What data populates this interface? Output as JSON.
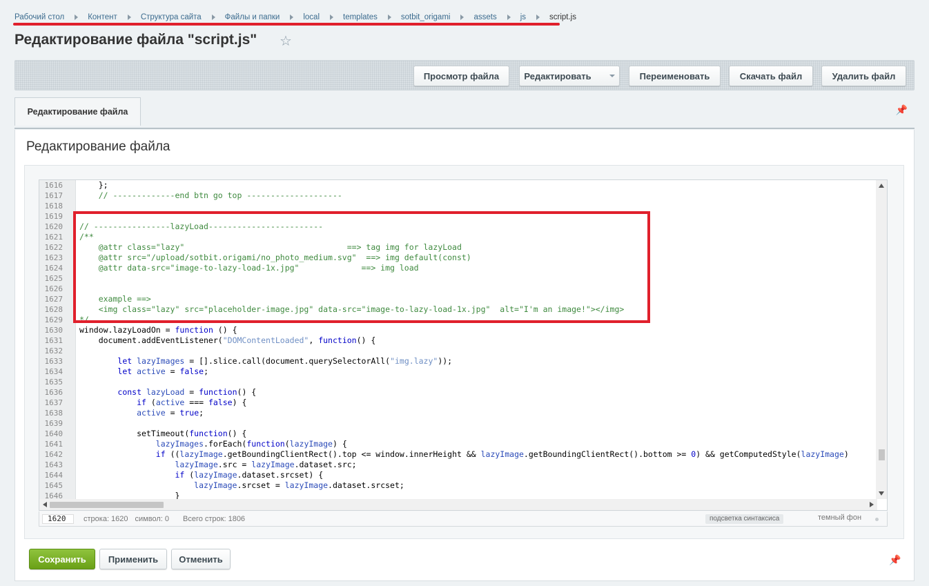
{
  "breadcrumb": {
    "items": [
      "Рабочий стол",
      "Контент",
      "Структура сайта",
      "Файлы и папки",
      "local",
      "templates",
      "sotbit_origami",
      "assets",
      "js",
      "script.js"
    ]
  },
  "page": {
    "title": "Редактирование файла \"script.js\""
  },
  "toolbar": {
    "view_label": "Просмотр файла",
    "edit_label": "Редактировать",
    "rename_label": "Переименовать",
    "download_label": "Скачать файл",
    "delete_label": "Удалить файл"
  },
  "tabs": [
    {
      "label": "Редактирование файла"
    }
  ],
  "panel": {
    "title": "Редактирование файла"
  },
  "editor": {
    "lines": [
      {
        "n": "1616",
        "parts": [
          {
            "t": "    };",
            "c": ""
          }
        ]
      },
      {
        "n": "1617",
        "parts": [
          {
            "t": "    // -------------end btn go top --------------------",
            "c": "cm"
          }
        ]
      },
      {
        "n": "1618",
        "parts": []
      },
      {
        "n": "1619",
        "parts": []
      },
      {
        "n": "1620",
        "parts": [
          {
            "t": "// ----------------lazyLoad------------------------",
            "c": "cm"
          }
        ]
      },
      {
        "n": "1621",
        "parts": [
          {
            "t": "/**",
            "c": "cm"
          }
        ]
      },
      {
        "n": "1622",
        "parts": [
          {
            "t": "    @attr class=\"lazy\"                                  ==> tag img for lazyLoad",
            "c": "cm"
          }
        ]
      },
      {
        "n": "1623",
        "parts": [
          {
            "t": "    @attr src=\"/upload/sotbit.origami/no_photo_medium.svg\"  ==> img default(const)",
            "c": "cm"
          }
        ]
      },
      {
        "n": "1624",
        "parts": [
          {
            "t": "    @attr data-src=\"image-to-lazy-load-1x.jpg\"             ==> img load",
            "c": "cm"
          }
        ]
      },
      {
        "n": "1625",
        "parts": []
      },
      {
        "n": "1626",
        "parts": []
      },
      {
        "n": "1627",
        "parts": [
          {
            "t": "    example ==>",
            "c": "cm"
          }
        ]
      },
      {
        "n": "1628",
        "parts": [
          {
            "t": "    <img class=\"lazy\" src=\"placeholder-image.jpg\" data-src=\"image-to-lazy-load-1x.jpg\"  alt=\"I'm an image!\"></img>",
            "c": "cm"
          }
        ]
      },
      {
        "n": "1629",
        "parts": [
          {
            "t": "*/",
            "c": "cm"
          }
        ]
      },
      {
        "n": "1630",
        "parts": [
          {
            "t": "window.lazyLoadOn = ",
            "c": ""
          },
          {
            "t": "function",
            "c": "kw"
          },
          {
            "t": " () {",
            "c": ""
          }
        ]
      },
      {
        "n": "1631",
        "parts": [
          {
            "t": "    document.addEventListener(",
            "c": ""
          },
          {
            "t": "\"DOMContentLoaded\"",
            "c": "str"
          },
          {
            "t": ", ",
            "c": ""
          },
          {
            "t": "function",
            "c": "kw"
          },
          {
            "t": "() {",
            "c": ""
          }
        ]
      },
      {
        "n": "1632",
        "parts": []
      },
      {
        "n": "1633",
        "parts": [
          {
            "t": "        ",
            "c": ""
          },
          {
            "t": "let",
            "c": "kw"
          },
          {
            "t": " ",
            "c": ""
          },
          {
            "t": "lazyImages",
            "c": "vr"
          },
          {
            "t": " = [].slice.call(document.querySelectorAll(",
            "c": ""
          },
          {
            "t": "\"img.lazy\"",
            "c": "str"
          },
          {
            "t": "));",
            "c": ""
          }
        ]
      },
      {
        "n": "1634",
        "parts": [
          {
            "t": "        ",
            "c": ""
          },
          {
            "t": "let",
            "c": "kw"
          },
          {
            "t": " ",
            "c": ""
          },
          {
            "t": "active",
            "c": "vr"
          },
          {
            "t": " = ",
            "c": ""
          },
          {
            "t": "false",
            "c": "kw"
          },
          {
            "t": ";",
            "c": ""
          }
        ]
      },
      {
        "n": "1635",
        "parts": []
      },
      {
        "n": "1636",
        "parts": [
          {
            "t": "        ",
            "c": ""
          },
          {
            "t": "const",
            "c": "kw"
          },
          {
            "t": " ",
            "c": ""
          },
          {
            "t": "lazyLoad",
            "c": "vr"
          },
          {
            "t": " = ",
            "c": ""
          },
          {
            "t": "function",
            "c": "kw"
          },
          {
            "t": "() {",
            "c": ""
          }
        ]
      },
      {
        "n": "1637",
        "parts": [
          {
            "t": "            ",
            "c": ""
          },
          {
            "t": "if",
            "c": "kw"
          },
          {
            "t": " (",
            "c": ""
          },
          {
            "t": "active",
            "c": "vr"
          },
          {
            "t": " === ",
            "c": ""
          },
          {
            "t": "false",
            "c": "kw"
          },
          {
            "t": ") {",
            "c": ""
          }
        ]
      },
      {
        "n": "1638",
        "parts": [
          {
            "t": "            ",
            "c": ""
          },
          {
            "t": "active",
            "c": "vr"
          },
          {
            "t": " = ",
            "c": ""
          },
          {
            "t": "true",
            "c": "kw"
          },
          {
            "t": ";",
            "c": ""
          }
        ]
      },
      {
        "n": "1639",
        "parts": []
      },
      {
        "n": "1640",
        "parts": [
          {
            "t": "            setTimeout(",
            "c": ""
          },
          {
            "t": "function",
            "c": "kw"
          },
          {
            "t": "() {",
            "c": ""
          }
        ]
      },
      {
        "n": "1641",
        "parts": [
          {
            "t": "                ",
            "c": ""
          },
          {
            "t": "lazyImages",
            "c": "vr"
          },
          {
            "t": ".forEach(",
            "c": ""
          },
          {
            "t": "function",
            "c": "kw"
          },
          {
            "t": "(",
            "c": ""
          },
          {
            "t": "lazyImage",
            "c": "vr"
          },
          {
            "t": ") {",
            "c": ""
          }
        ]
      },
      {
        "n": "1642",
        "parts": [
          {
            "t": "                ",
            "c": ""
          },
          {
            "t": "if",
            "c": "kw"
          },
          {
            "t": " ((",
            "c": ""
          },
          {
            "t": "lazyImage",
            "c": "vr"
          },
          {
            "t": ".getBoundingClientRect().top <= window.innerHeight && ",
            "c": ""
          },
          {
            "t": "lazyImage",
            "c": "vr"
          },
          {
            "t": ".getBoundingClientRect().bottom >= ",
            "c": ""
          },
          {
            "t": "0",
            "c": "kw"
          },
          {
            "t": ") && getComputedStyle(",
            "c": ""
          },
          {
            "t": "lazyImage",
            "c": "vr"
          },
          {
            "t": ")",
            "c": ""
          }
        ]
      },
      {
        "n": "1643",
        "parts": [
          {
            "t": "                    ",
            "c": ""
          },
          {
            "t": "lazyImage",
            "c": "vr"
          },
          {
            "t": ".src = ",
            "c": ""
          },
          {
            "t": "lazyImage",
            "c": "vr"
          },
          {
            "t": ".dataset.src;",
            "c": ""
          }
        ]
      },
      {
        "n": "1644",
        "parts": [
          {
            "t": "                    ",
            "c": ""
          },
          {
            "t": "if",
            "c": "kw"
          },
          {
            "t": " (",
            "c": ""
          },
          {
            "t": "lazyImage",
            "c": "vr"
          },
          {
            "t": ".dataset.srcset) {",
            "c": ""
          }
        ]
      },
      {
        "n": "1645",
        "parts": [
          {
            "t": "                        ",
            "c": ""
          },
          {
            "t": "lazyImage",
            "c": "vr"
          },
          {
            "t": ".srcset = ",
            "c": ""
          },
          {
            "t": "lazyImage",
            "c": "vr"
          },
          {
            "t": ".dataset.srcset;",
            "c": ""
          }
        ]
      },
      {
        "n": "1646",
        "parts": [
          {
            "t": "                    }",
            "c": ""
          }
        ]
      }
    ]
  },
  "statusbar": {
    "line_input": "1620",
    "line_text": "строка: 1620",
    "char_text": "символ: 0",
    "total_text": "Всего строк: 1806",
    "highlight_label": "подсветка синтаксиса",
    "dark_label": "темный фон"
  },
  "actions": {
    "save_label": "Сохранить",
    "apply_label": "Применить",
    "cancel_label": "Отменить"
  },
  "colors": {
    "accent_red": "#e0202c",
    "save_green": "#6aa017",
    "comment": "#3f8a3f",
    "keyword": "#0000c8",
    "string": "#6f8fc4"
  }
}
